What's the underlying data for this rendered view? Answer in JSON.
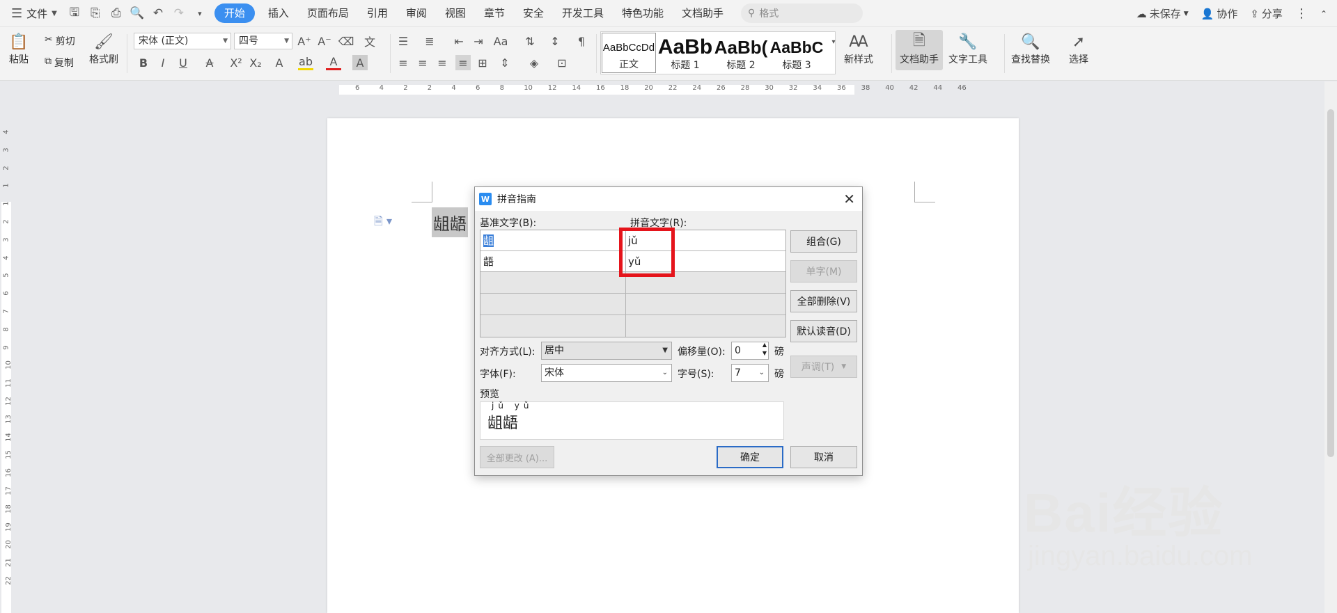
{
  "menubar": {
    "file": "文件",
    "tabs": [
      "开始",
      "插入",
      "页面布局",
      "引用",
      "审阅",
      "视图",
      "章节",
      "安全",
      "开发工具",
      "特色功能",
      "文档助手"
    ],
    "search_placeholder": "格式",
    "unsaved": "未保存",
    "collab": "协作",
    "share": "分享"
  },
  "toolbar": {
    "paste": "粘贴",
    "cut": "剪切",
    "copy": "复制",
    "format_painter": "格式刷",
    "font_name": "宋体 (正文)",
    "font_size": "四号",
    "styles": [
      {
        "preview": "AaBbCcDd",
        "label": "正文"
      },
      {
        "preview": "AaBb",
        "label": "标题 1"
      },
      {
        "preview": "AaBb(",
        "label": "标题 2"
      },
      {
        "preview": "AaBbC",
        "label": "标题 3"
      }
    ],
    "new_style": "新样式",
    "doc_assistant": "文档助手",
    "text_tools": "文字工具",
    "find_replace": "查找替换",
    "select": "选择"
  },
  "ruler": {
    "h_ticks": [
      "6",
      "4",
      "2",
      "2",
      "4",
      "6",
      "8",
      "10",
      "12",
      "14",
      "16",
      "18",
      "20",
      "22",
      "24",
      "26",
      "28",
      "30",
      "32",
      "34",
      "36",
      "38",
      "40",
      "42",
      "44",
      "46"
    ],
    "v_ticks": [
      "4",
      "3",
      "2",
      "1",
      "1",
      "2",
      "3",
      "4",
      "5",
      "6",
      "7",
      "8",
      "9",
      "10",
      "11",
      "12",
      "13",
      "14",
      "15",
      "16",
      "17",
      "18",
      "19",
      "20",
      "21",
      "22"
    ]
  },
  "document": {
    "selected_text": "龃龉"
  },
  "dialog": {
    "title": "拼音指南",
    "base_label": "基准文字(B):",
    "ruby_label": "拼音文字(R):",
    "rows": [
      {
        "base": "龃",
        "ruby": "jǔ"
      },
      {
        "base": "龉",
        "ruby": "yǔ"
      },
      {
        "base": "",
        "ruby": ""
      },
      {
        "base": "",
        "ruby": ""
      },
      {
        "base": "",
        "ruby": ""
      }
    ],
    "buttons": {
      "group": "组合(G)",
      "mono": "单字(M)",
      "clear_all": "全部删除(V)",
      "default": "默认读音(D)",
      "tone": "声调(T)",
      "change_all": "全部更改 (A)...",
      "ok": "确定",
      "cancel": "取消"
    },
    "align_label": "对齐方式(L):",
    "align_value": "居中",
    "offset_label": "偏移量(O):",
    "offset_value": "0",
    "unit": "磅",
    "font_label": "字体(F):",
    "font_value": "宋体",
    "size_label": "字号(S):",
    "size_value": "7",
    "preview_label": "预览",
    "preview_pinyin": "jǔ yǔ",
    "preview_chars": "龃龉"
  },
  "watermark": {
    "line1": "Bai经验",
    "line2": "jingyan.baidu.com"
  }
}
